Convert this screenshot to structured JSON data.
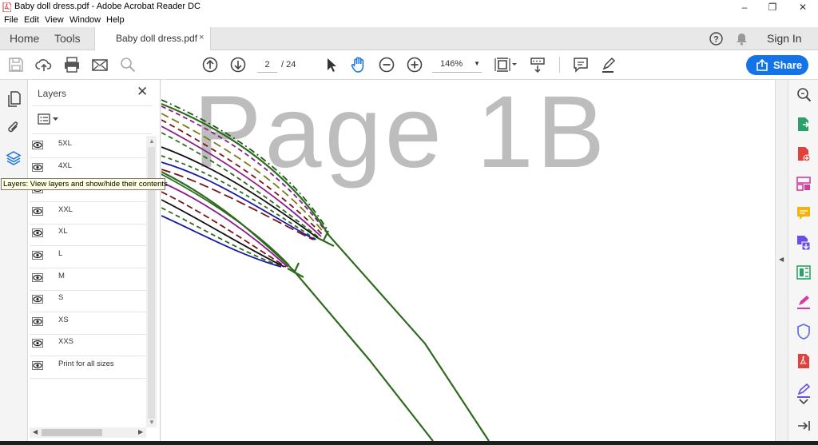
{
  "window": {
    "title": "Baby doll dress.pdf - Adobe Acrobat Reader DC",
    "controls": [
      "–",
      "❐",
      "✕"
    ]
  },
  "menu": [
    "File",
    "Edit",
    "View",
    "Window",
    "Help"
  ],
  "tabs": {
    "home": "Home",
    "tools": "Tools",
    "document": "Baby doll dress.pdf",
    "close": "×",
    "help": "?",
    "sign_in": "Sign In"
  },
  "toolbar": {
    "page_current": "2",
    "page_total": "/ 24",
    "zoom": "146%",
    "share": "Share"
  },
  "layers_panel": {
    "title": "Layers",
    "close": "✕",
    "layers": [
      "5XL",
      "4XL",
      "3XL",
      "XXL",
      "XL",
      "L",
      "M",
      "S",
      "XS",
      "XXS",
      "Print for all sizes"
    ]
  },
  "tooltip": "Layers: View layers and show/hide their contents",
  "document": {
    "watermark": "Page 1B"
  },
  "colors": {
    "accent": "#1473e6",
    "line_green": "#2e6b1f",
    "line_darkgreen": "#1f5a14",
    "line_purple": "#8a1b8a",
    "line_maroon": "#7a1416",
    "line_navy": "#1a1aa6",
    "line_black": "#111111",
    "line_olive": "#7a7a1a"
  },
  "icons": {
    "left_rail": [
      "pages-icon",
      "attachment-icon",
      "layers-icon"
    ],
    "right_rail": [
      "zoom-search-icon",
      "export-pdf-icon",
      "create-pdf-icon",
      "organize-pages-icon",
      "comment-icon",
      "combine-files-icon",
      "compress-icon",
      "fill-sign-icon",
      "protect-icon",
      "pdf-icon",
      "edit-pdf-icon",
      "collapse-panel-icon"
    ]
  }
}
